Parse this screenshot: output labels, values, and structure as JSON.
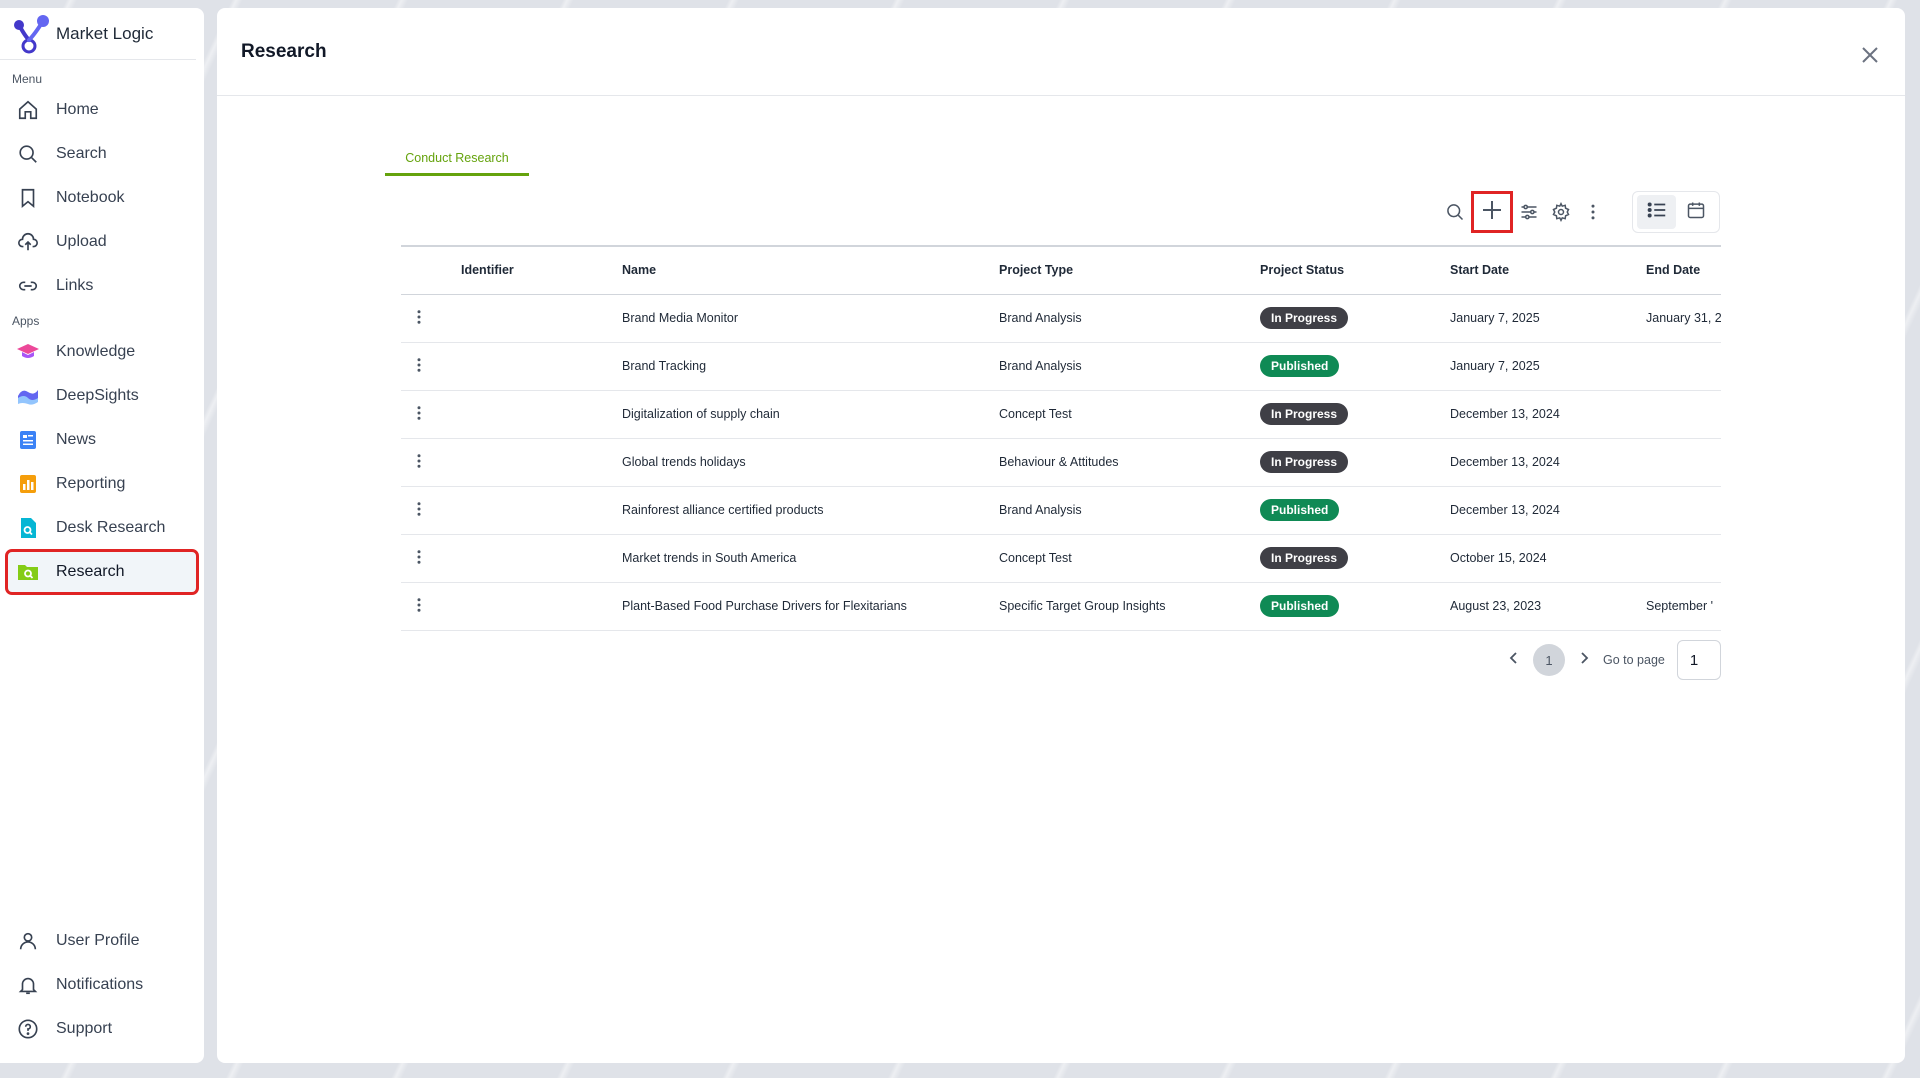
{
  "brand": {
    "name": "Market Logic"
  },
  "sidebar": {
    "menu_label": "Menu",
    "apps_label": "Apps",
    "menu": [
      {
        "label": "Home",
        "icon": "home-icon"
      },
      {
        "label": "Search",
        "icon": "search-icon"
      },
      {
        "label": "Notebook",
        "icon": "bookmark-icon"
      },
      {
        "label": "Upload",
        "icon": "cloud-upload-icon"
      },
      {
        "label": "Links",
        "icon": "link-icon"
      }
    ],
    "apps": [
      {
        "label": "Knowledge",
        "icon": "graduation-cap-icon",
        "color": "#ec4899"
      },
      {
        "label": "DeepSights",
        "icon": "wave-icon",
        "color": "#6366f1"
      },
      {
        "label": "News",
        "icon": "news-icon",
        "color": "#3b82f6"
      },
      {
        "label": "Reporting",
        "icon": "bar-chart-icon",
        "color": "#f59e0b"
      },
      {
        "label": "Desk Research",
        "icon": "document-search-icon",
        "color": "#06b6d4"
      },
      {
        "label": "Research",
        "icon": "folder-search-icon",
        "color": "#84cc16",
        "active": true
      }
    ],
    "bottom": [
      {
        "label": "User Profile",
        "icon": "user-icon"
      },
      {
        "label": "Notifications",
        "icon": "bell-icon"
      },
      {
        "label": "Support",
        "icon": "help-circle-icon"
      }
    ]
  },
  "main": {
    "title": "Research",
    "tab_label": "Conduct Research",
    "toolbar_icons": [
      "search-icon",
      "plus-icon",
      "sliders-icon",
      "gear-icon",
      "more-vertical-icon"
    ],
    "view_icons": [
      "list-icon",
      "calendar-icon"
    ]
  },
  "table": {
    "columns": [
      "",
      "Identifier",
      "Name",
      "Project Type",
      "Project Status",
      "Start Date",
      "End Date"
    ],
    "rows": [
      {
        "identifier": "",
        "name": "Brand Media Monitor",
        "type": "Brand Analysis",
        "status": "In Progress",
        "start": "January 7, 2025",
        "end": "January 31, 2"
      },
      {
        "identifier": "",
        "name": "Brand Tracking",
        "type": "Brand Analysis",
        "status": "Published",
        "start": "January 7, 2025",
        "end": ""
      },
      {
        "identifier": "",
        "name": "Digitalization of supply chain",
        "type": "Concept Test",
        "status": "In Progress",
        "start": "December 13, 2024",
        "end": ""
      },
      {
        "identifier": "",
        "name": "Global trends holidays",
        "type": "Behaviour & Attitudes",
        "status": "In Progress",
        "start": "December 13, 2024",
        "end": ""
      },
      {
        "identifier": "",
        "name": "Rainforest alliance certified products",
        "type": "Brand Analysis",
        "status": "Published",
        "start": "December 13, 2024",
        "end": ""
      },
      {
        "identifier": "",
        "name": "Market trends in South America",
        "type": "Concept Test",
        "status": "In Progress",
        "start": "October 15, 2024",
        "end": ""
      },
      {
        "identifier": "",
        "name": "Plant-Based Food Purchase Drivers for Flexitarians",
        "type": "Specific Target Group Insights",
        "status": "Published",
        "start": "August 23, 2023",
        "end": "September '"
      }
    ]
  },
  "pagination": {
    "current_page": "1",
    "goto_label": "Go to page",
    "goto_value": "1"
  },
  "colors": {
    "accent": "#65a30d",
    "in_progress": "#3f3f46",
    "published": "#0f8a55",
    "highlight": "#e02424"
  }
}
